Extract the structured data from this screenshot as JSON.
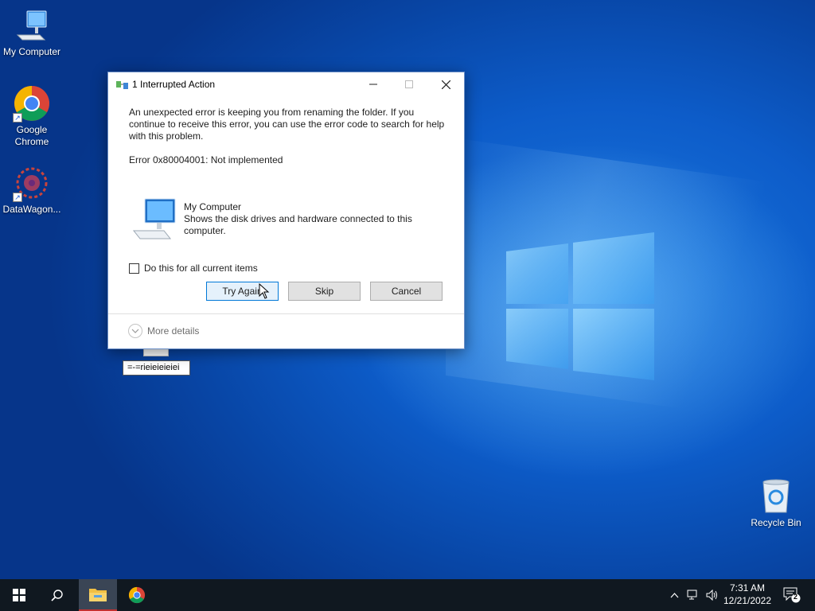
{
  "desktop": {
    "icons": [
      {
        "label": "My Computer",
        "icon": "computer-icon"
      },
      {
        "label": "Google Chrome",
        "icon": "chrome-icon"
      },
      {
        "label": "DataWagon...",
        "icon": "datawagon-icon"
      },
      {
        "label": "Recycle Bin",
        "icon": "recycle-bin-icon"
      }
    ]
  },
  "dialog": {
    "title": "1 Interrupted Action",
    "message": "An unexpected error is keeping you from renaming the folder. If you continue to receive this error, you can use the error code to search for help with this problem.",
    "error": "Error 0x80004001: Not implemented",
    "item_name": "My Computer",
    "item_description": "Shows the disk drives and hardware connected to this computer.",
    "checkbox_label": "Do this for all current items",
    "checkbox_checked": false,
    "buttons": {
      "try_again": "Try Again",
      "skip": "Skip",
      "cancel": "Cancel"
    },
    "more_details": "More details"
  },
  "rename_field": {
    "value": "=-=rieieieieiei"
  },
  "taskbar": {
    "clock_time": "7:31 AM",
    "clock_date": "12/21/2022",
    "notification_count": "2",
    "pinned": [
      "start-icon",
      "search-icon",
      "file-explorer-icon",
      "chrome-icon"
    ]
  },
  "colors": {
    "accent": "#0078d7",
    "taskbar": "#101820",
    "desktop": "#0d5cc9"
  }
}
